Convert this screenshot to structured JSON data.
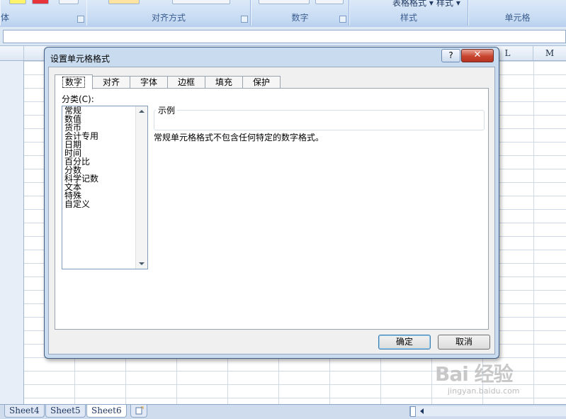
{
  "ribbon": {
    "groups": [
      "对齐方式",
      "数字",
      "样式",
      "单元格"
    ],
    "partial_left_label": "体",
    "style_buttons": [
      "表格格式 ▾",
      "样式 ▾"
    ]
  },
  "columns": [
    "L",
    "M"
  ],
  "sheet_tabs": [
    "Sheet4",
    "Sheet5",
    "Sheet6"
  ],
  "active_sheet": "Sheet6",
  "dialog": {
    "title": "设置单元格格式",
    "help_glyph": "?",
    "close_glyph": "✕",
    "tabs": [
      "数字",
      "对齐",
      "字体",
      "边框",
      "填充",
      "保护"
    ],
    "active_tab": "数字",
    "category_label": "分类(C):",
    "categories": [
      "常规",
      "数值",
      "货币",
      "会计专用",
      "日期",
      "时间",
      "百分比",
      "分数",
      "科学记数",
      "文本",
      "特殊",
      "自定义"
    ],
    "selected_category": "常规",
    "sample_legend": "示例",
    "description": "常规单元格格式不包含任何特定的数字格式。",
    "ok_label": "确定",
    "cancel_label": "取消"
  },
  "watermark": {
    "text": "Bai 经验",
    "sub": "jingyan.baidu.com"
  }
}
